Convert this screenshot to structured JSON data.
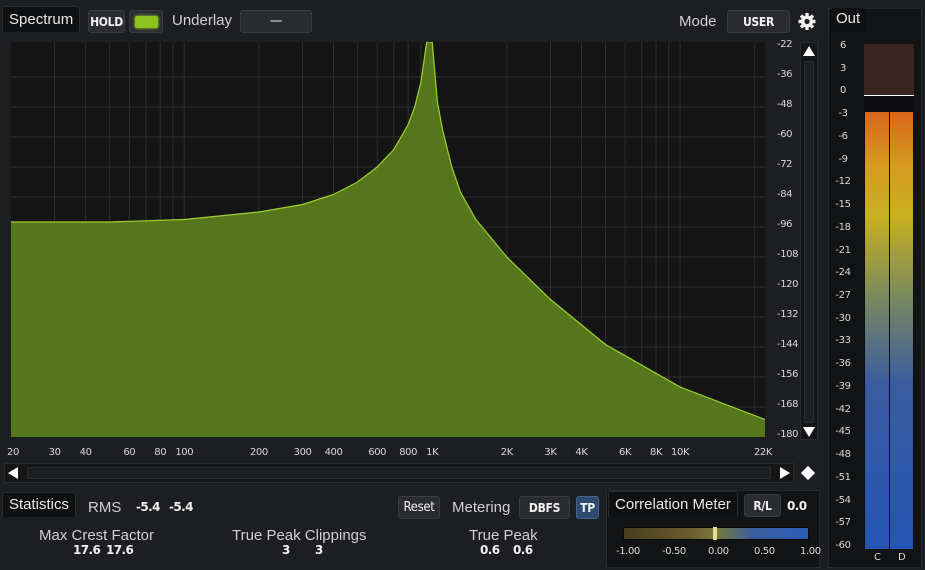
{
  "spectrum": {
    "tab_label": "Spectrum",
    "hold_label": "HOLD",
    "hold_color": "#8cc21c",
    "underlay_label": "Underlay",
    "underlay_value": "—",
    "mode_label": "Mode",
    "mode_value": "USER",
    "fill_color": "#5a7f1c",
    "line_color": "#9fd030",
    "db_ticks": [
      "-22",
      "-36",
      "-48",
      "-60",
      "-72",
      "-84",
      "-96",
      "-108",
      "-120",
      "-132",
      "-144",
      "-156",
      "-168",
      "-180"
    ],
    "freq_ticks": [
      "20",
      "30",
      "40",
      "60",
      "80",
      "100",
      "200",
      "300",
      "400",
      "600",
      "800",
      "1K",
      "2K",
      "3K",
      "4K",
      "6K",
      "8K",
      "10K",
      "22K"
    ]
  },
  "chart_data": {
    "type": "area",
    "x_scale": "log",
    "xlabel": "",
    "ylabel": "",
    "xlim": [
      20,
      22000
    ],
    "ylim": [
      -180,
      -22
    ],
    "grid": true,
    "series": [
      {
        "x": [
          20,
          50,
          100,
          200,
          300,
          400,
          500,
          600,
          700,
          800,
          850,
          900,
          950,
          1000,
          1050,
          1100,
          1200,
          1300,
          1500,
          2000,
          3000,
          5000,
          10000,
          22000
        ],
        "y": [
          -94,
          -94,
          -93,
          -90,
          -87,
          -83,
          -78,
          -72,
          -65,
          -55,
          -48,
          -38,
          -22,
          -22,
          -46,
          -57,
          -72,
          -82,
          -93,
          -108,
          -125,
          -143,
          -160,
          -173
        ]
      }
    ]
  },
  "statistics": {
    "tab_label": "Statistics",
    "rms_label": "RMS",
    "rms_values": [
      "-5.4",
      "-5.4"
    ],
    "reset_label": "Reset",
    "metering_label": "Metering",
    "metering_value": "DBFS",
    "tp_label": "TP",
    "crest_label": "Max Crest Factor",
    "crest_values": [
      "17.6",
      "17.6"
    ],
    "clip_label": "True Peak Clippings",
    "clip_values": [
      "3",
      "3"
    ],
    "tp_peak_label": "True Peak",
    "tp_peak_values": [
      "0.6",
      "0.6"
    ]
  },
  "correlation": {
    "tab_label": "Correlation Meter",
    "rl_label": "R/L",
    "rl_value": "0.0",
    "ticks": [
      "-1.00",
      "-0.50",
      "0.00",
      "0.50",
      "1.00"
    ],
    "value": 0.0
  },
  "out": {
    "tab_label": "Out",
    "ticks": [
      "6",
      "3",
      "0",
      "-3",
      "-6",
      "-9",
      "-12",
      "-15",
      "-18",
      "-21",
      "-24",
      "-27",
      "-30",
      "-33",
      "-36",
      "-39",
      "-42",
      "-45",
      "-48",
      "-51",
      "-54",
      "-57",
      "-60"
    ],
    "channels": [
      "C",
      "D"
    ],
    "level_db": -3
  }
}
